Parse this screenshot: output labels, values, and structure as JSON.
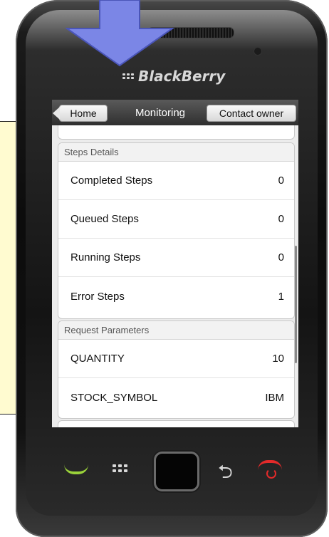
{
  "device": {
    "brand": "BlackBerry"
  },
  "titlebar": {
    "home_label": "Home",
    "title": "Monitoring",
    "contact_label": "Contact owner"
  },
  "steps_details": {
    "header": "Steps Details",
    "rows": [
      {
        "label": "Completed Steps",
        "value": "0"
      },
      {
        "label": "Queued Steps",
        "value": "0"
      },
      {
        "label": "Running Steps",
        "value": "0"
      },
      {
        "label": "Error Steps",
        "value": "1"
      }
    ]
  },
  "request_parameters": {
    "header": "Request Parameters",
    "rows": [
      {
        "label": "QUANTITY",
        "value": "10"
      },
      {
        "label": "STOCK_SYMBOL",
        "value": "IBM"
      }
    ]
  },
  "colors": {
    "arrow": "#7b86e6",
    "note_background": "#fffbd0",
    "call_key": "#9ad23a",
    "end_key": "#e32a2a"
  },
  "icons": [
    "down-arrow-icon",
    "blackberry-logo-icon",
    "call-icon",
    "menu-icon",
    "trackpad",
    "back-icon",
    "end-call-icon"
  ]
}
